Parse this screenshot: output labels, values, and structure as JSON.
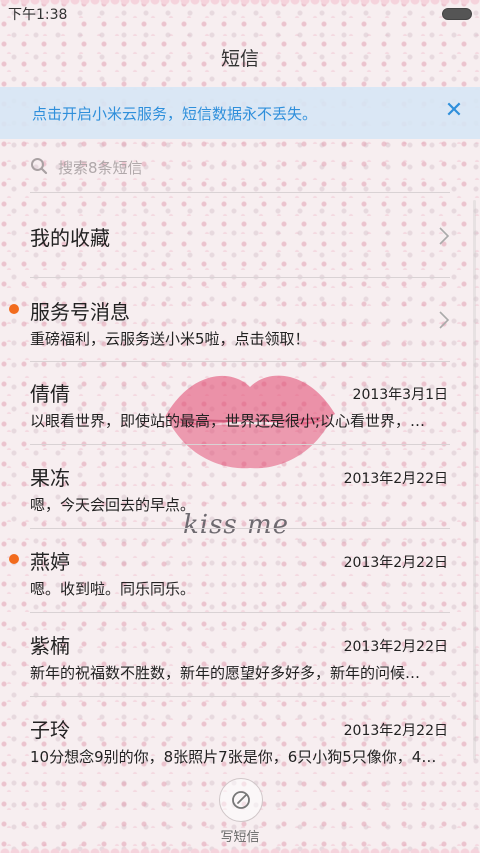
{
  "status": {
    "time": "下午1:38"
  },
  "title": "短信",
  "banner": {
    "text": "点击开启小米云服务，短信数据永不丢失。",
    "close": "✕"
  },
  "search": {
    "placeholder": "搜索8条短信"
  },
  "favorites": {
    "label": "我的收藏"
  },
  "conversations": [
    {
      "name": "服务号消息",
      "date": "",
      "preview": "重磅福利，云服务送小米5啦，点击领取！",
      "unread": true
    },
    {
      "name": "倩倩",
      "date": "2013年3月1日",
      "preview": "以眼看世界，即使站的最高，世界还是很小;以心看世界，…",
      "unread": false
    },
    {
      "name": "果冻",
      "date": "2013年2月22日",
      "preview": "嗯，今天会回去的早点。",
      "unread": false
    },
    {
      "name": "燕婷",
      "date": "2013年2月22日",
      "preview": "嗯。收到啦。同乐同乐。",
      "unread": true
    },
    {
      "name": "紫楠",
      "date": "2013年2月22日",
      "preview": "新年的祝福数不胜数，新年的愿望好多好多，新年的问候…",
      "unread": false
    },
    {
      "name": "子玲",
      "date": "2013年2月22日",
      "preview": "10分想念9别的你，8张照片7张是你，6只小狗5只像你，4…",
      "unread": false
    }
  ],
  "wallpaper_text": "kiss me",
  "compose": {
    "label": "写短信"
  },
  "colors": {
    "accent": "#2f8fdb",
    "unread_dot": "#f26b1d"
  }
}
